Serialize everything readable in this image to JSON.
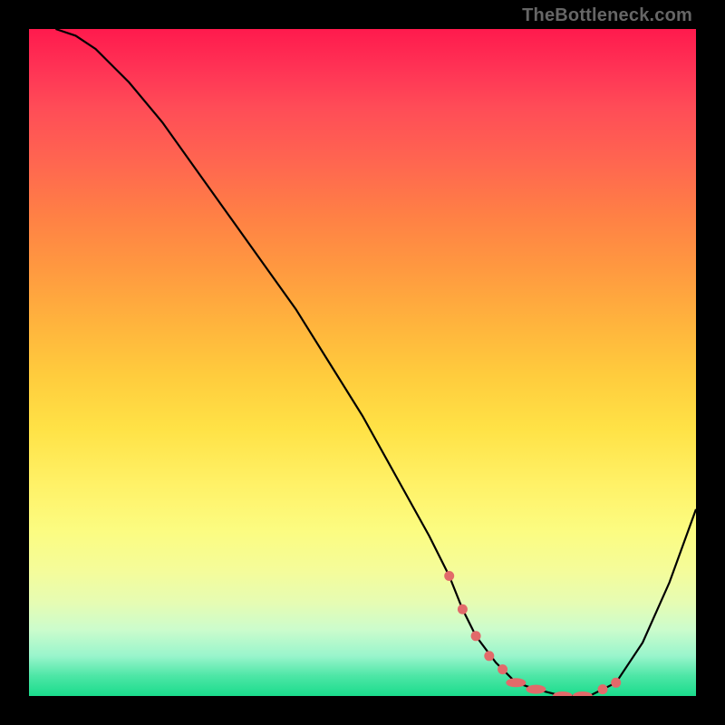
{
  "watermark": "TheBottleneck.com",
  "chart_data": {
    "type": "line",
    "title": "",
    "xlabel": "",
    "ylabel": "",
    "xlim": [
      0,
      100
    ],
    "ylim": [
      0,
      100
    ],
    "grid": false,
    "legend": false,
    "series": [
      {
        "name": "bottleneck-curve",
        "x": [
          4,
          7,
          10,
          15,
          20,
          25,
          30,
          35,
          40,
          45,
          50,
          55,
          60,
          63,
          65,
          67,
          70,
          73,
          76,
          80,
          84,
          88,
          92,
          96,
          100
        ],
        "values": [
          100,
          99,
          97,
          92,
          86,
          79,
          72,
          65,
          58,
          50,
          42,
          33,
          24,
          18,
          13,
          9,
          5,
          2,
          1,
          0,
          0,
          2,
          8,
          17,
          28
        ]
      }
    ],
    "markers": {
      "name": "highlight-points",
      "x": [
        63,
        65,
        67,
        69,
        71,
        73,
        76,
        80,
        83,
        86,
        88
      ],
      "values": [
        18,
        13,
        9,
        6,
        4,
        2,
        1,
        0,
        0,
        1,
        2
      ]
    },
    "background_gradient": {
      "top": "#ff1a4d",
      "mid": "#fff166",
      "bottom": "#1adc8c"
    }
  }
}
